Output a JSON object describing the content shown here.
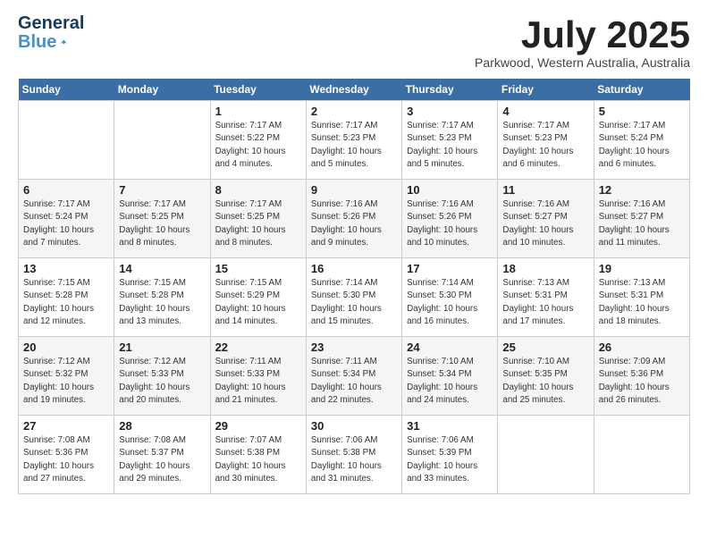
{
  "header": {
    "logo_line1": "General",
    "logo_line2": "Blue",
    "month": "July 2025",
    "location": "Parkwood, Western Australia, Australia"
  },
  "weekdays": [
    "Sunday",
    "Monday",
    "Tuesday",
    "Wednesday",
    "Thursday",
    "Friday",
    "Saturday"
  ],
  "weeks": [
    [
      {
        "day": "",
        "info": ""
      },
      {
        "day": "",
        "info": ""
      },
      {
        "day": "1",
        "info": "Sunrise: 7:17 AM\nSunset: 5:22 PM\nDaylight: 10 hours\nand 4 minutes."
      },
      {
        "day": "2",
        "info": "Sunrise: 7:17 AM\nSunset: 5:23 PM\nDaylight: 10 hours\nand 5 minutes."
      },
      {
        "day": "3",
        "info": "Sunrise: 7:17 AM\nSunset: 5:23 PM\nDaylight: 10 hours\nand 5 minutes."
      },
      {
        "day": "4",
        "info": "Sunrise: 7:17 AM\nSunset: 5:23 PM\nDaylight: 10 hours\nand 6 minutes."
      },
      {
        "day": "5",
        "info": "Sunrise: 7:17 AM\nSunset: 5:24 PM\nDaylight: 10 hours\nand 6 minutes."
      }
    ],
    [
      {
        "day": "6",
        "info": "Sunrise: 7:17 AM\nSunset: 5:24 PM\nDaylight: 10 hours\nand 7 minutes."
      },
      {
        "day": "7",
        "info": "Sunrise: 7:17 AM\nSunset: 5:25 PM\nDaylight: 10 hours\nand 8 minutes."
      },
      {
        "day": "8",
        "info": "Sunrise: 7:17 AM\nSunset: 5:25 PM\nDaylight: 10 hours\nand 8 minutes."
      },
      {
        "day": "9",
        "info": "Sunrise: 7:16 AM\nSunset: 5:26 PM\nDaylight: 10 hours\nand 9 minutes."
      },
      {
        "day": "10",
        "info": "Sunrise: 7:16 AM\nSunset: 5:26 PM\nDaylight: 10 hours\nand 10 minutes."
      },
      {
        "day": "11",
        "info": "Sunrise: 7:16 AM\nSunset: 5:27 PM\nDaylight: 10 hours\nand 10 minutes."
      },
      {
        "day": "12",
        "info": "Sunrise: 7:16 AM\nSunset: 5:27 PM\nDaylight: 10 hours\nand 11 minutes."
      }
    ],
    [
      {
        "day": "13",
        "info": "Sunrise: 7:15 AM\nSunset: 5:28 PM\nDaylight: 10 hours\nand 12 minutes."
      },
      {
        "day": "14",
        "info": "Sunrise: 7:15 AM\nSunset: 5:28 PM\nDaylight: 10 hours\nand 13 minutes."
      },
      {
        "day": "15",
        "info": "Sunrise: 7:15 AM\nSunset: 5:29 PM\nDaylight: 10 hours\nand 14 minutes."
      },
      {
        "day": "16",
        "info": "Sunrise: 7:14 AM\nSunset: 5:30 PM\nDaylight: 10 hours\nand 15 minutes."
      },
      {
        "day": "17",
        "info": "Sunrise: 7:14 AM\nSunset: 5:30 PM\nDaylight: 10 hours\nand 16 minutes."
      },
      {
        "day": "18",
        "info": "Sunrise: 7:13 AM\nSunset: 5:31 PM\nDaylight: 10 hours\nand 17 minutes."
      },
      {
        "day": "19",
        "info": "Sunrise: 7:13 AM\nSunset: 5:31 PM\nDaylight: 10 hours\nand 18 minutes."
      }
    ],
    [
      {
        "day": "20",
        "info": "Sunrise: 7:12 AM\nSunset: 5:32 PM\nDaylight: 10 hours\nand 19 minutes."
      },
      {
        "day": "21",
        "info": "Sunrise: 7:12 AM\nSunset: 5:33 PM\nDaylight: 10 hours\nand 20 minutes."
      },
      {
        "day": "22",
        "info": "Sunrise: 7:11 AM\nSunset: 5:33 PM\nDaylight: 10 hours\nand 21 minutes."
      },
      {
        "day": "23",
        "info": "Sunrise: 7:11 AM\nSunset: 5:34 PM\nDaylight: 10 hours\nand 22 minutes."
      },
      {
        "day": "24",
        "info": "Sunrise: 7:10 AM\nSunset: 5:34 PM\nDaylight: 10 hours\nand 24 minutes."
      },
      {
        "day": "25",
        "info": "Sunrise: 7:10 AM\nSunset: 5:35 PM\nDaylight: 10 hours\nand 25 minutes."
      },
      {
        "day": "26",
        "info": "Sunrise: 7:09 AM\nSunset: 5:36 PM\nDaylight: 10 hours\nand 26 minutes."
      }
    ],
    [
      {
        "day": "27",
        "info": "Sunrise: 7:08 AM\nSunset: 5:36 PM\nDaylight: 10 hours\nand 27 minutes."
      },
      {
        "day": "28",
        "info": "Sunrise: 7:08 AM\nSunset: 5:37 PM\nDaylight: 10 hours\nand 29 minutes."
      },
      {
        "day": "29",
        "info": "Sunrise: 7:07 AM\nSunset: 5:38 PM\nDaylight: 10 hours\nand 30 minutes."
      },
      {
        "day": "30",
        "info": "Sunrise: 7:06 AM\nSunset: 5:38 PM\nDaylight: 10 hours\nand 31 minutes."
      },
      {
        "day": "31",
        "info": "Sunrise: 7:06 AM\nSunset: 5:39 PM\nDaylight: 10 hours\nand 33 minutes."
      },
      {
        "day": "",
        "info": ""
      },
      {
        "day": "",
        "info": ""
      }
    ]
  ]
}
